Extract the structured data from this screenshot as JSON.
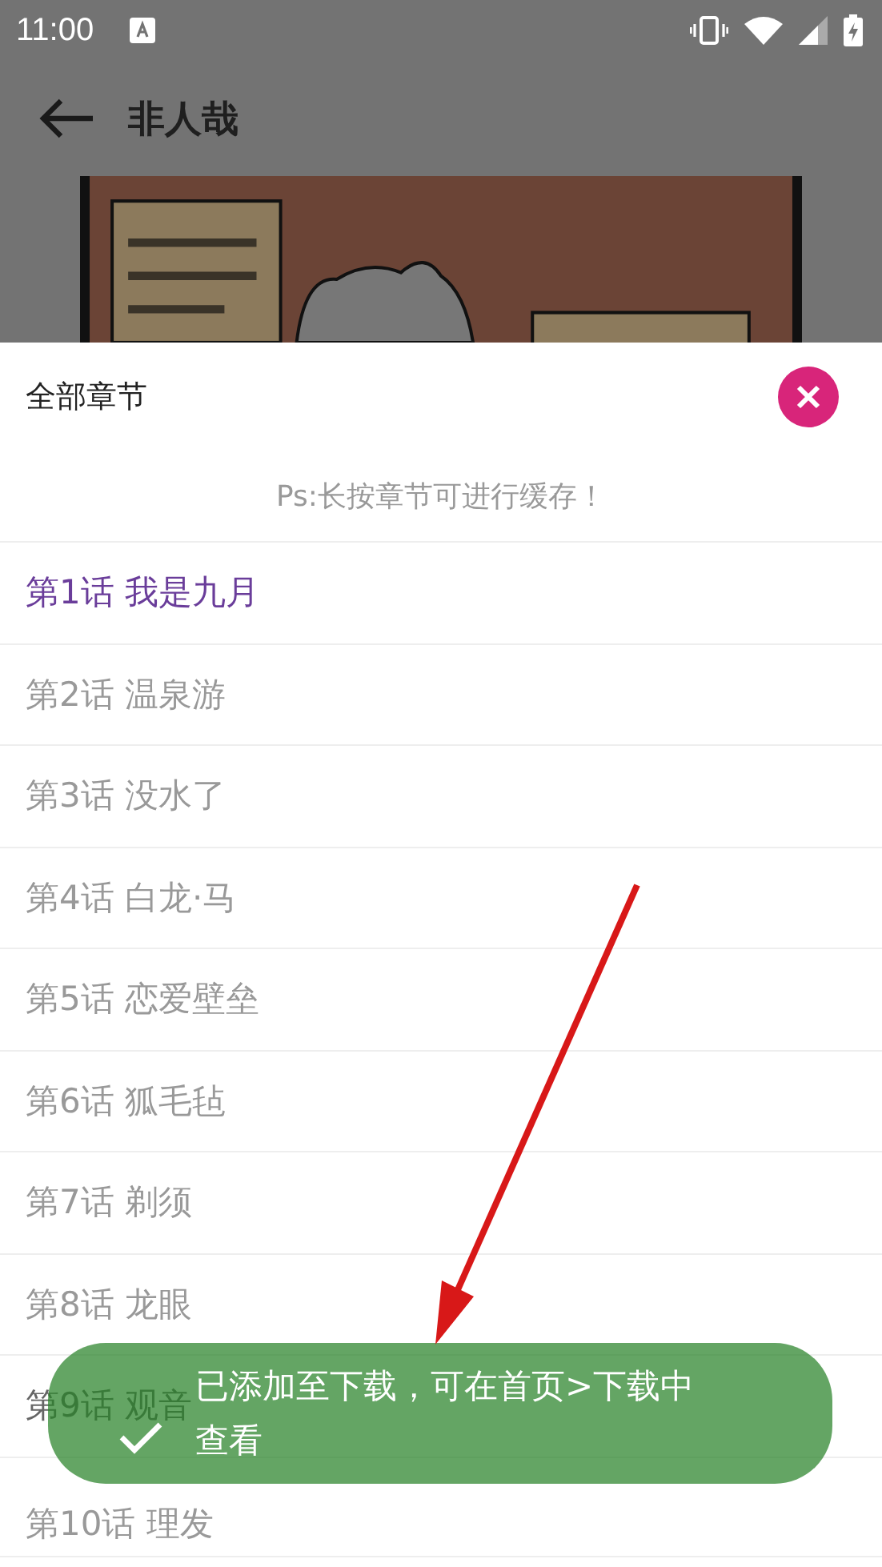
{
  "status_bar": {
    "time": "11:00"
  },
  "app_bar": {
    "title": "非人哉"
  },
  "sheet": {
    "title": "全部章节",
    "hint": "Ps:长按章节可进行缓存！",
    "chapters": [
      {
        "label": "第1话 我是九月",
        "selected": true
      },
      {
        "label": "第2话 温泉游",
        "selected": false
      },
      {
        "label": "第3话 没水了",
        "selected": false
      },
      {
        "label": "第4话 白龙·马",
        "selected": false
      },
      {
        "label": "第5话 恋爱壁垒",
        "selected": false
      },
      {
        "label": "第6话 狐毛毡",
        "selected": false
      },
      {
        "label": "第7话 剃须",
        "selected": false
      },
      {
        "label": "第8话 龙眼",
        "selected": false
      },
      {
        "label": "第9话 观音",
        "selected": false
      },
      {
        "label": "第10话 理发",
        "selected": false
      }
    ]
  },
  "toast": {
    "message": "已添加至下载，可在首页>下载中查看"
  }
}
